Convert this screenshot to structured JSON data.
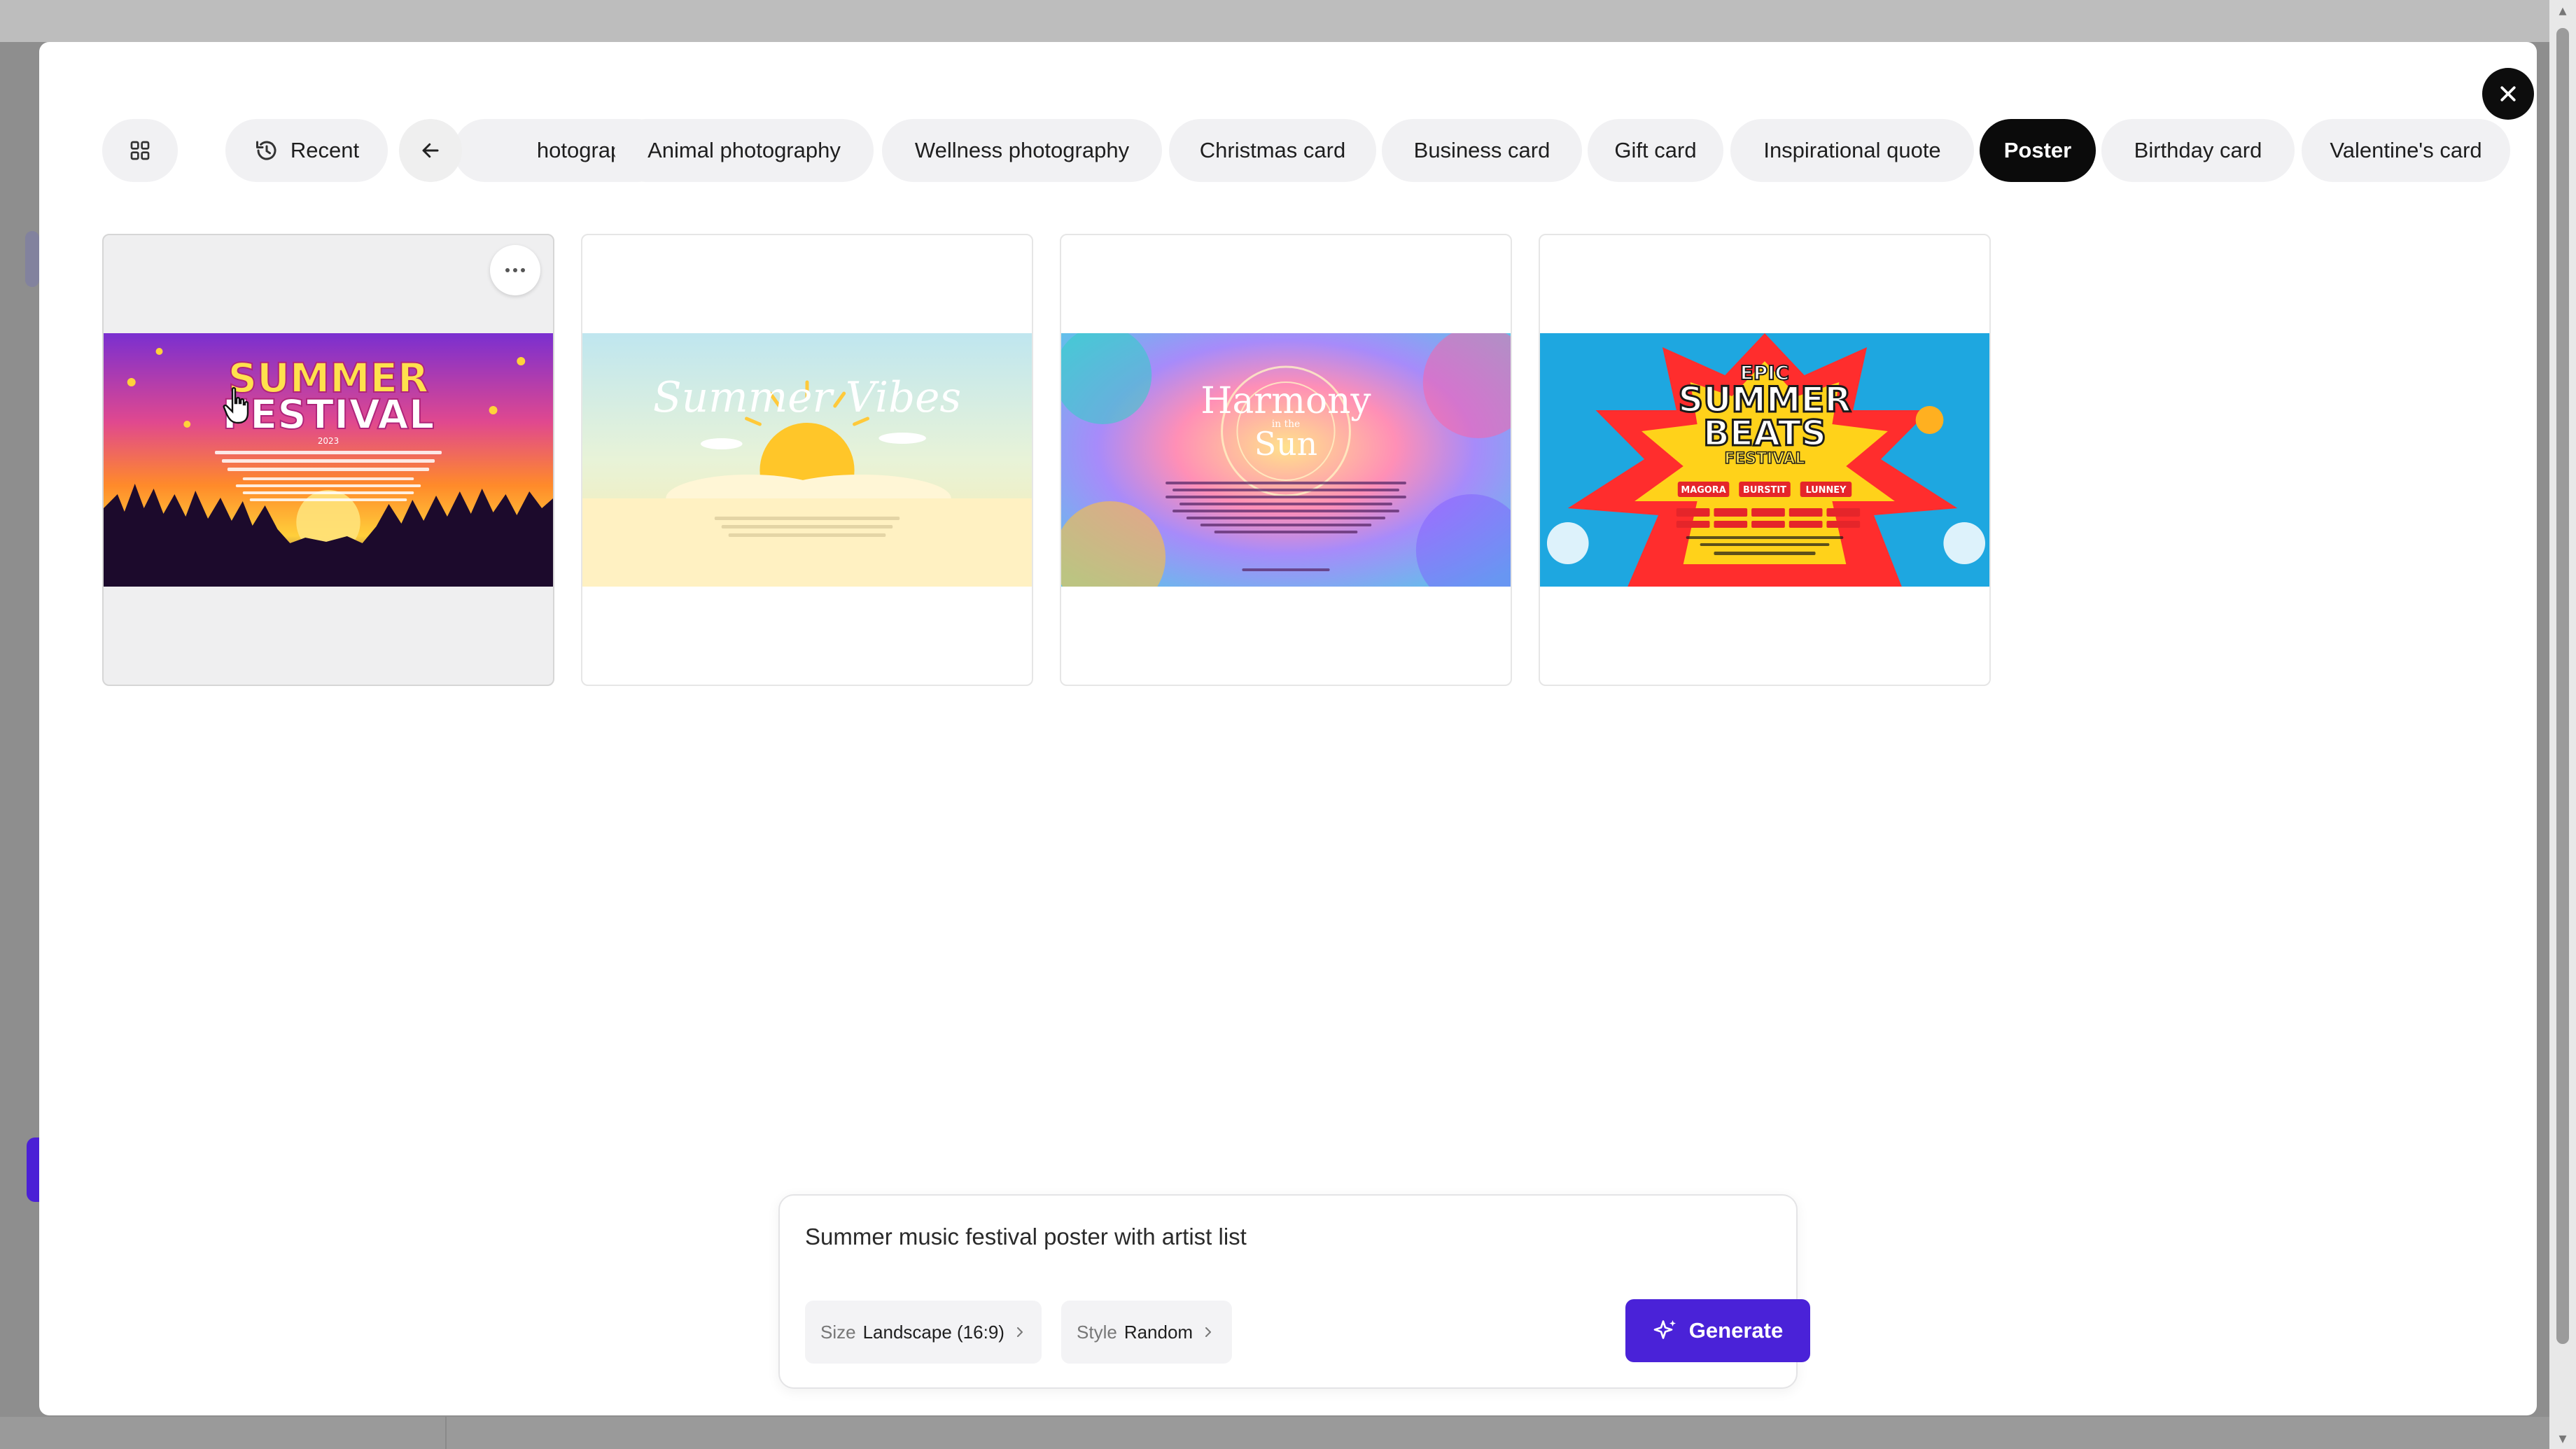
{
  "categories": {
    "clipped_label": "hotography",
    "items": [
      {
        "label": "Recent"
      },
      {
        "label": "Animal photography"
      },
      {
        "label": "Wellness photography"
      },
      {
        "label": "Christmas card"
      },
      {
        "label": "Business card"
      },
      {
        "label": "Gift card"
      },
      {
        "label": "Inspirational quote"
      },
      {
        "label": "Poster"
      },
      {
        "label": "Birthday card"
      },
      {
        "label": "Valentine's card"
      }
    ],
    "active": "Poster"
  },
  "results": [
    {
      "title_line1": "SUMMER",
      "title_line2": "FESTIVAL",
      "year": "2023"
    },
    {
      "title": "Summer Vibes"
    },
    {
      "title": "Harmony",
      "subtitle": "in the",
      "title_line2": "Sun"
    },
    {
      "title_line1": "EPIC",
      "title_line2": "SUMMER",
      "title_line3": "BEATS",
      "title_line4": "FESTIVAL",
      "artists": [
        "MAGORA",
        "BURSTIT",
        "LUNNEY"
      ]
    }
  ],
  "prompt": {
    "value": "Summer music festival poster with artist list",
    "size_key": "Size",
    "size_value": "Landscape (16:9)",
    "style_key": "Style",
    "style_value": "Random",
    "generate_label": "Generate"
  },
  "colors": {
    "accent": "#4a22d8",
    "active_chip": "#0b0b0b"
  }
}
